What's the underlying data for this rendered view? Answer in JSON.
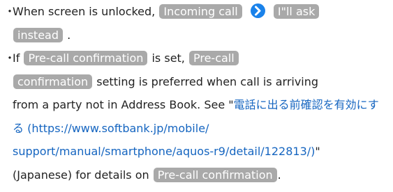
{
  "notes": {
    "bullet": "・",
    "item1": {
      "text_a": "When screen is unlocked,",
      "key_incoming_call": "Incoming call",
      "arrow_icon": "arrow-right-circle-icon",
      "key_ask_instead_line1": "I\"ll ask",
      "key_ask_instead_line2": "instead",
      "text_end": "."
    },
    "item2": {
      "text_a": "If",
      "key_pre_call_1": "Pre-call confirmation",
      "text_b": "is set,",
      "key_pre_call_2_line1": "Pre-call",
      "key_pre_call_2_line2": "confirmation",
      "text_c": "setting is preferred when call is arriving",
      "text_d": "from a party not in Address Book. See \"",
      "link_title": "電話に出る前確認を有効にする",
      "link_url_part1": "(https://www.softbank.jp/mobile/",
      "link_url_part2": "support/manual/smartphone/aquos-r9/detail/122813/)",
      "text_e": "\"",
      "text_f": "(Japanese) for details on",
      "key_pre_call_3": "Pre-call confirmation",
      "text_end": "."
    }
  },
  "colors": {
    "key_background": "#a9a9a9",
    "key_text": "#ffffff",
    "arrow_circle": "#1a82ea",
    "link": "#1565c0",
    "body_text": "#222222"
  }
}
